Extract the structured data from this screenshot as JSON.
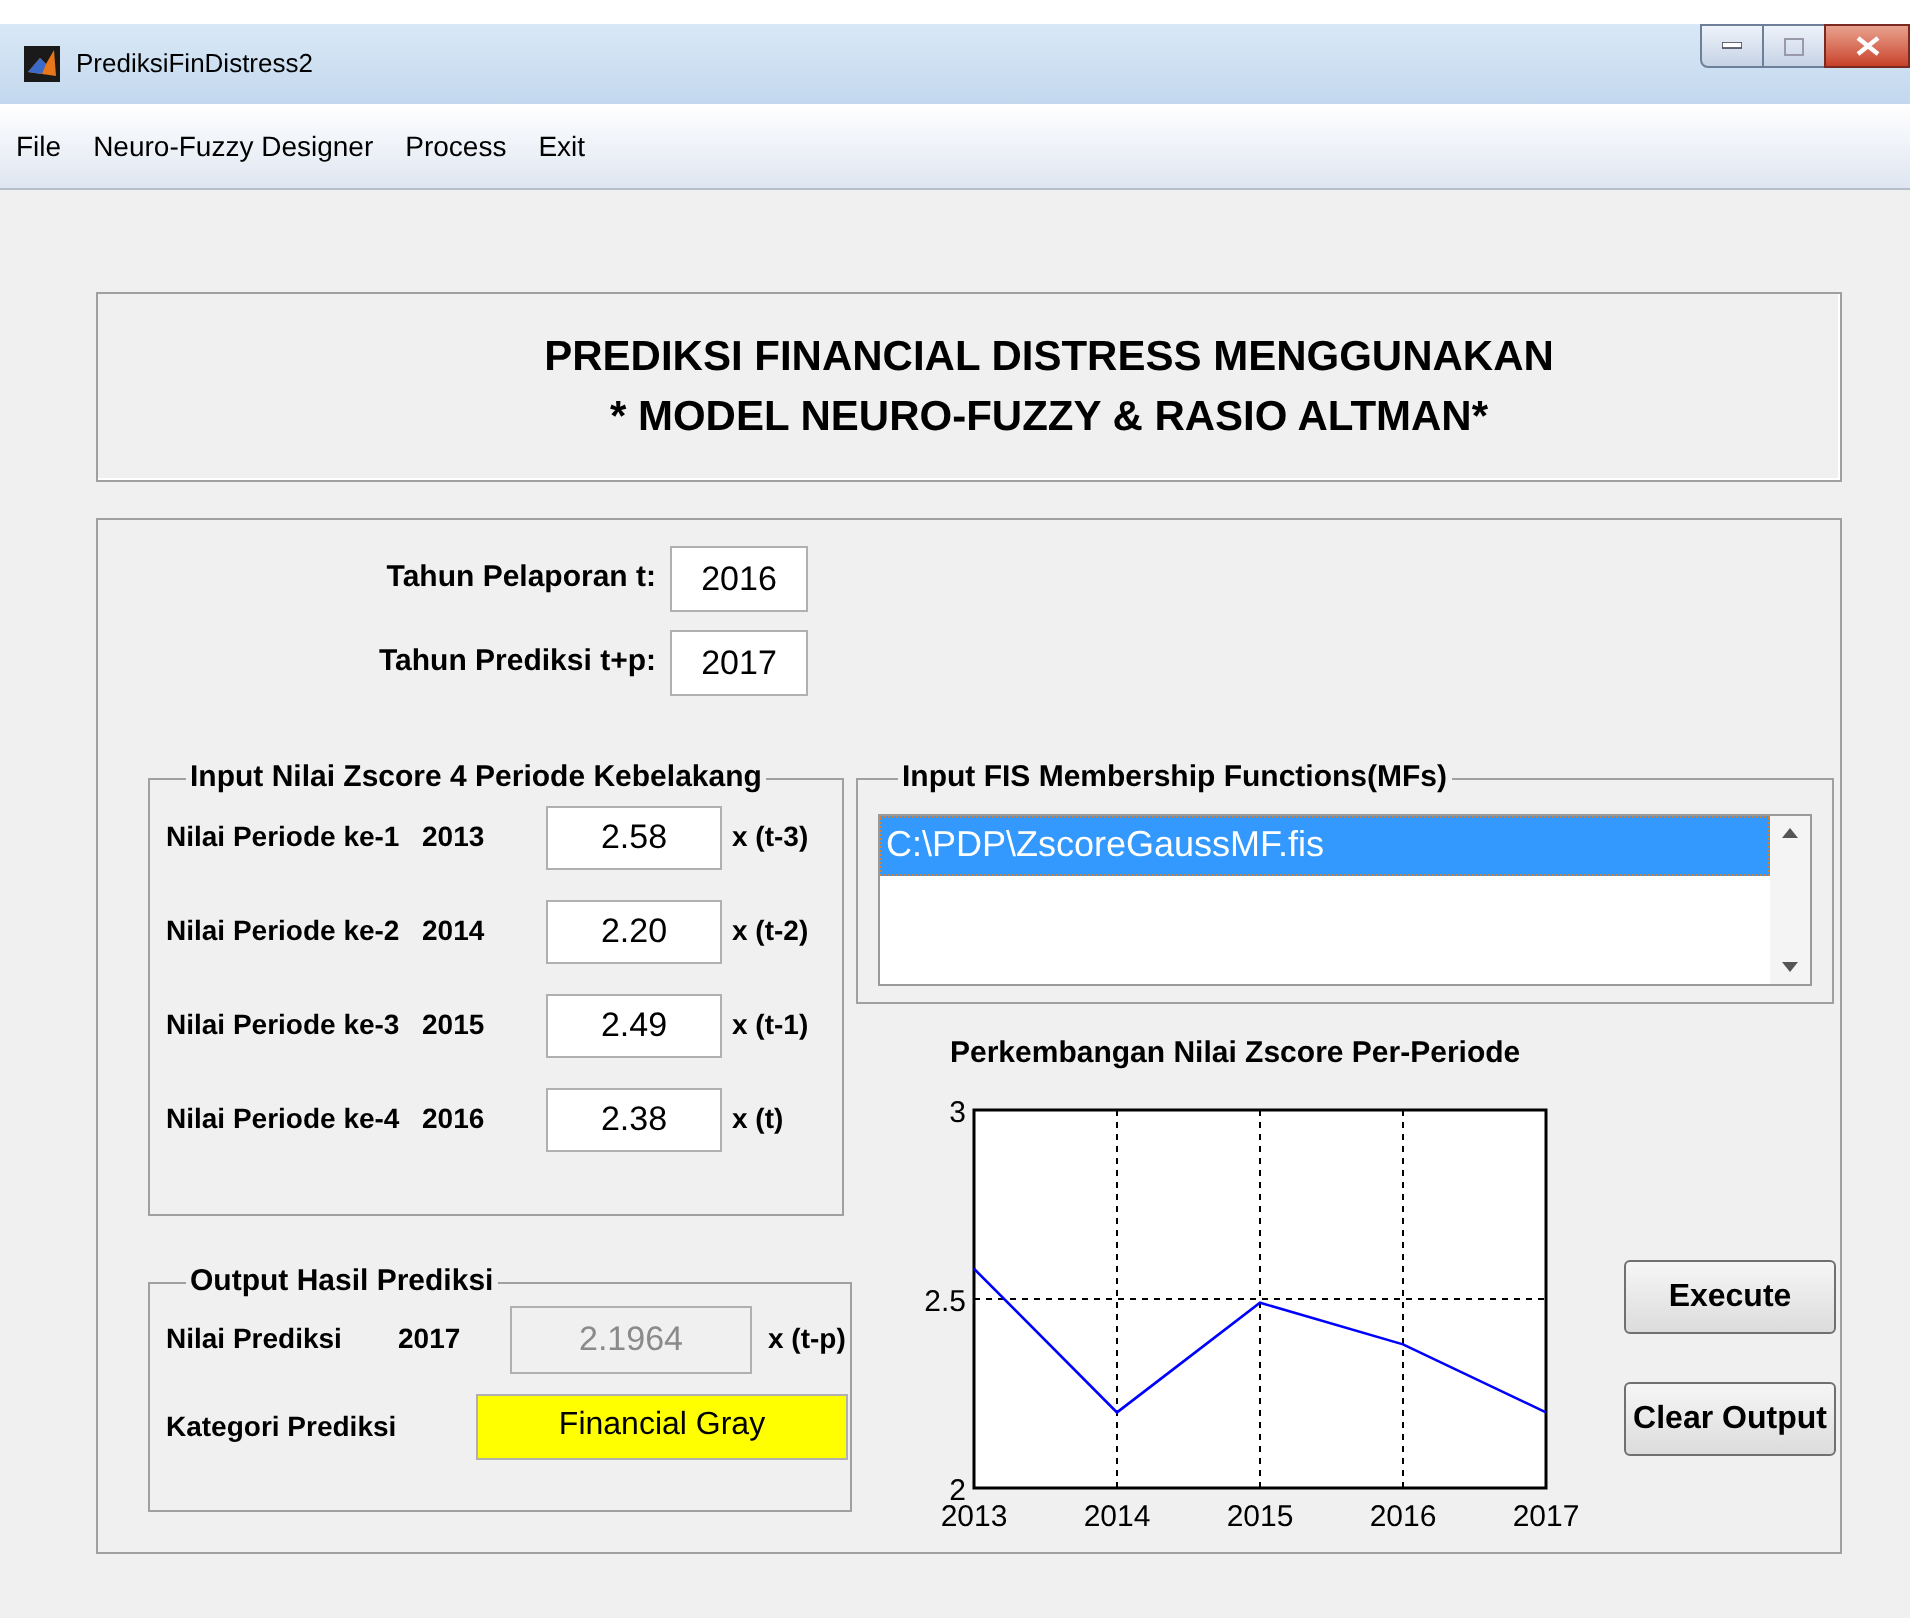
{
  "window": {
    "title": "PrediksiFinDistress2"
  },
  "menu": [
    "File",
    "Neuro-Fuzzy Designer",
    "Process",
    "Exit"
  ],
  "header": {
    "lines": [
      "PREDIKSI FINANCIAL DISTRESS MENGGUNAKAN",
      "* MODEL NEURO-FUZZY & RASIO ALTMAN*"
    ]
  },
  "years": [
    {
      "label": "Tahun Pelaporan t:",
      "value": "2016"
    },
    {
      "label": "Tahun Prediksi t+p:",
      "value": "2017"
    }
  ],
  "zscore_input": {
    "title": "Input Nilai Zscore 4 Periode Kebelakang",
    "rows": [
      {
        "label": "Nilai Periode ke-1",
        "year": "2013",
        "value": "2.58",
        "suffix": "x (t-3)"
      },
      {
        "label": "Nilai Periode ke-2",
        "year": "2014",
        "value": "2.20",
        "suffix": "x (t-2)"
      },
      {
        "label": "Nilai Periode ke-3",
        "year": "2015",
        "value": "2.49",
        "suffix": "x (t-1)"
      },
      {
        "label": "Nilai Periode ke-4",
        "year": "2016",
        "value": "2.38",
        "suffix": "x (t)"
      }
    ]
  },
  "fis_input": {
    "title": "Input FIS Membership Functions(MFs)",
    "items": [
      {
        "label": "C:\\PDP\\ZscoreGaussMF.fis",
        "selected": true
      }
    ]
  },
  "output": {
    "title": "Output Hasil Prediksi",
    "prediction": {
      "label": "Nilai Prediksi",
      "year": "2017",
      "value": "2.1964",
      "suffix": "x (t-p)",
      "disabled": true
    },
    "category": {
      "label": "Kategori Prediksi",
      "value": "Financial Gray",
      "color": "#ffff00"
    }
  },
  "chart": {
    "chart_data": {
      "type": "line",
      "title": "Perkembangan Nilai Zscore Per-Periode",
      "categories": [
        "2013",
        "2014",
        "2015",
        "2016",
        "2017"
      ],
      "series": [
        {
          "color": "#0000ff",
          "values": [
            2.58,
            2.2,
            2.49,
            2.38,
            2.2
          ]
        }
      ],
      "grid": true,
      "ylim": [
        2,
        3
      ],
      "yticks": [
        2,
        2.5,
        3
      ]
    }
  },
  "buttons": [
    "Execute",
    "Clear Output"
  ]
}
